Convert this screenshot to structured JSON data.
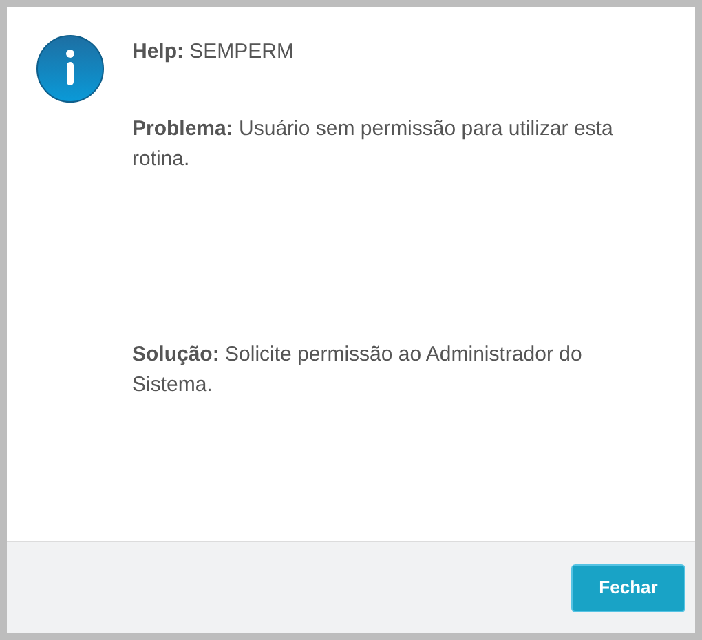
{
  "messages": [
    {
      "text": "**Help:** SEMPERM"
    },
    {
      "text": "**Problema:** Usuário sem permissão para utilizar esta rotina."
    },
    {
      "text": "**Solução:** Solicite permissão ao Administrador do Sistema."
    }
  ],
  "buttons": [
    "Fechar"
  ]
}
